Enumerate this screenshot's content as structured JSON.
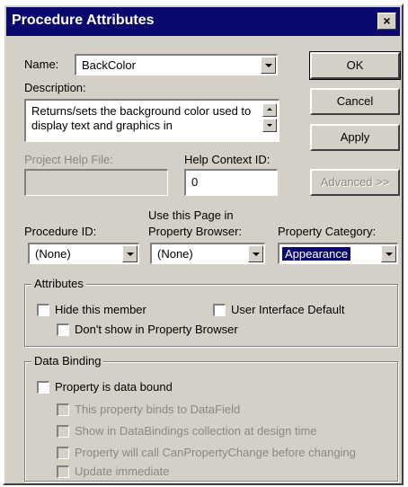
{
  "window": {
    "title": "Procedure Attributes",
    "close_glyph": "×"
  },
  "name": {
    "label": "Name:",
    "value": "BackColor"
  },
  "description": {
    "label": "Description:",
    "value": "Returns/sets the background color used to display text and graphics in"
  },
  "project_help_file": {
    "label": "Project Help File:",
    "value": ""
  },
  "help_context_id": {
    "label": "Help Context ID:",
    "value": "0"
  },
  "procedure_id": {
    "label": "Procedure ID:",
    "value": "(None)"
  },
  "property_browser_page": {
    "label_line1": "Use this Page in",
    "label_line2": "Property Browser:",
    "value": "(None)"
  },
  "property_category": {
    "label": "Property Category:",
    "value": "Appearance"
  },
  "buttons": {
    "ok": "OK",
    "cancel": "Cancel",
    "apply": "Apply",
    "advanced": "Advanced >>"
  },
  "attributes": {
    "title": "Attributes",
    "hide_member": "Hide this member",
    "ui_default": "User Interface Default",
    "dont_show": "Don't show in Property Browser"
  },
  "data_binding": {
    "title": "Data Binding",
    "is_data_bound": "Property is data bound",
    "binds_to_datafield": "This property binds to DataField",
    "show_in_databindings": "Show in DataBindings collection at design time",
    "call_canpropertychange": "Property will call CanPropertyChange before changing",
    "update_immediate": "Update immediate"
  },
  "colors": {
    "title_bar": "#0a0a6e",
    "face": "#d4d0c8",
    "selection": "#0a0a6e",
    "disabled_text": "#8a8880"
  },
  "icons": {
    "close": "close-icon",
    "dropdown": "chevron-down-icon",
    "spin_up": "arrow-up-icon",
    "spin_down": "arrow-down-icon"
  }
}
